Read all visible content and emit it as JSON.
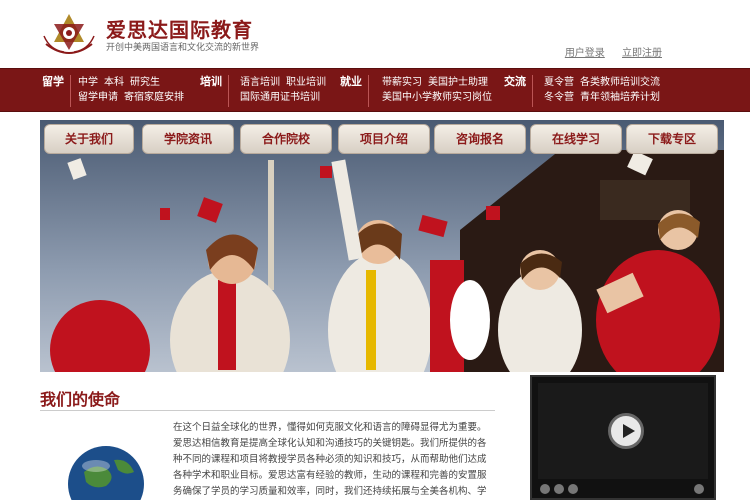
{
  "header": {
    "brand_title": "爱思达国际教育",
    "brand_slogan": "开创中美两国语言和文化交流的新世界",
    "login_label": "用户登录",
    "register_label": "立即注册"
  },
  "nav": {
    "groups": [
      {
        "category": "留学",
        "links": [
          [
            "中学",
            "本科",
            "研究生"
          ],
          [
            "留学申请",
            "寄宿家庭安排"
          ]
        ]
      },
      {
        "category": "培训",
        "links": [
          [
            "语言培训",
            "职业培训"
          ],
          [
            "国际通用证书培训"
          ]
        ]
      },
      {
        "category": "就业",
        "links": [
          [
            "带薪实习",
            "美国护士助理"
          ],
          [
            "美国中小学教师实习岗位"
          ]
        ]
      },
      {
        "category": "交流",
        "links": [
          [
            "夏令营",
            "各类教师培训交流"
          ],
          [
            "冬令营",
            "青年领袖培养计划"
          ]
        ]
      }
    ]
  },
  "tabs": [
    "关于我们",
    "学院资讯",
    "合作院校",
    "项目介绍",
    "咨询报名",
    "在线学习",
    "下载专区"
  ],
  "mission": {
    "title": "我们的使命",
    "text": "在这个日益全球化的世界，懂得如何克服文化和语言的障碍显得尤为重要。爱思达相信教育是提高全球化认知和沟通技巧的关键钥匙。我们所提供的各种不同的课程和项目将教授学员各种必须的知识和技巧，从而帮助他们达成各种学术和职业目标。爱思达富有经验的教师，生动的课程和完善的安置服务确保了学员的学习质量和效率，同时，我们还持续拓展与全美各机构、学校和商店"
  },
  "colors": {
    "brand": "#8b1a1a",
    "navbar": "#7a1616"
  }
}
